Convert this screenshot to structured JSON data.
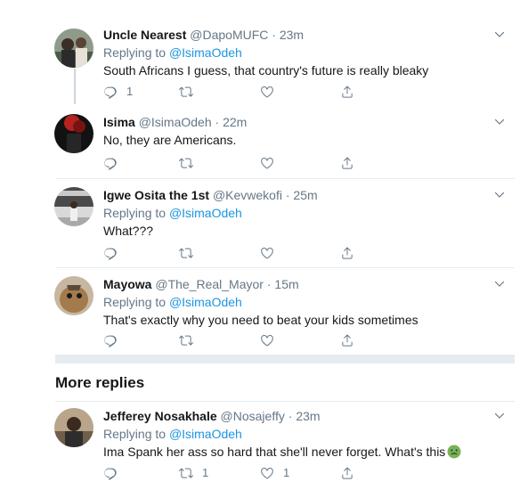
{
  "tweets": [
    {
      "name": "Uncle Nearest",
      "handle": "@DapoMUFC",
      "sep": "·",
      "time": "23m",
      "replying_prefix": "Replying to",
      "replying_to": "@IsimaOdeh",
      "text": "South Africans I guess, that country's future is really bleaky",
      "reply_count": "1",
      "retweet_count": "",
      "like_count": ""
    },
    {
      "name": "Isima",
      "handle": "@IsimaOdeh",
      "sep": "·",
      "time": "22m",
      "text": "No, they are Americans.",
      "reply_count": "",
      "retweet_count": "",
      "like_count": ""
    },
    {
      "name": "Igwe Osita the 1st",
      "handle": "@Kevwekofi",
      "sep": "·",
      "time": "25m",
      "replying_prefix": "Replying to",
      "replying_to": "@IsimaOdeh",
      "text": "What???",
      "reply_count": "",
      "retweet_count": "",
      "like_count": ""
    },
    {
      "name": "Mayowa",
      "handle": "@The_Real_Mayor",
      "sep": "·",
      "time": "15m",
      "replying_prefix": "Replying to",
      "replying_to": "@IsimaOdeh",
      "text": "That's exactly why you need to beat your kids sometimes",
      "reply_count": "",
      "retweet_count": "",
      "like_count": ""
    }
  ],
  "more_replies_heading": "More replies",
  "more": [
    {
      "name": "Jefferey Nosakhale",
      "handle": "@Nosajeffy",
      "sep": "·",
      "time": "23m",
      "replying_prefix": "Replying to",
      "replying_to": "@IsimaOdeh",
      "text": "Ima Spank her ass so hard that she'll never forget. What's this",
      "emoji": "nauseated-face-emoji",
      "reply_count": "",
      "retweet_count": "1",
      "like_count": "1"
    }
  ],
  "colors": {
    "link": "#1b95e0",
    "secondary_text": "#657786",
    "divider": "#e6ecf0",
    "emoji_green": "#77b255"
  },
  "icons": [
    "reply-icon",
    "retweet-icon",
    "like-icon",
    "share-icon",
    "chevron-down-icon"
  ]
}
